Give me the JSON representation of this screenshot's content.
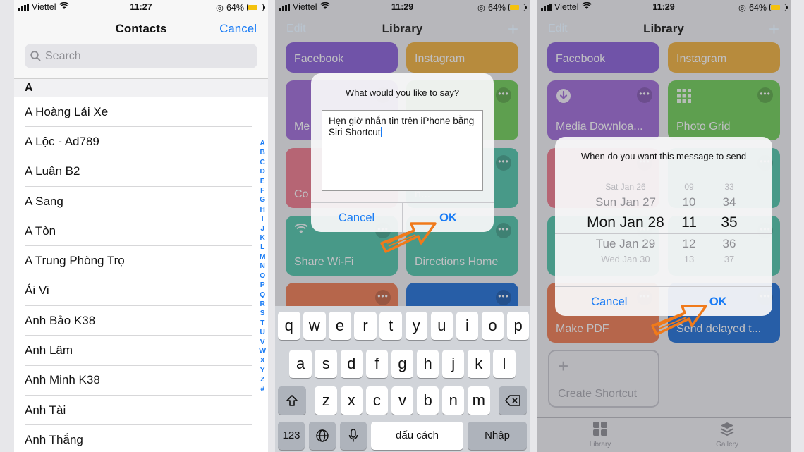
{
  "status": {
    "carrier": "Viettel",
    "battery": "64%",
    "battery_level": 0.64,
    "times": [
      "11:27",
      "11:29",
      "11:29"
    ]
  },
  "contacts": {
    "title": "Contacts",
    "cancel": "Cancel",
    "search_placeholder": "Search",
    "section": "A",
    "items": [
      "A Hoàng Lái Xe",
      "A Lộc - Ad789",
      "A Luân B2",
      "A Sang",
      "A Tòn",
      "A Trung Phòng Trọ",
      "Ái Vi",
      "Anh Bảo K38",
      "Anh Lâm",
      "Anh Minh K38",
      "Anh Tài",
      "Anh Thắng"
    ],
    "index": [
      "A",
      "B",
      "C",
      "D",
      "E",
      "F",
      "G",
      "H",
      "I",
      "J",
      "K",
      "L",
      "M",
      "N",
      "O",
      "P",
      "Q",
      "R",
      "S",
      "T",
      "U",
      "V",
      "W",
      "X",
      "Y",
      "Z",
      "#"
    ]
  },
  "library": {
    "title": "Library",
    "edit": "Edit",
    "tiles_p2": [
      {
        "label": "Facebook",
        "color": "#8a5fd8"
      },
      {
        "label": "Instagram",
        "color": "#f2b23a"
      },
      {
        "label": "Me",
        "color": "#a06ad8"
      },
      {
        "label": "",
        "color": "#6fcf55"
      },
      {
        "label": "Co",
        "color": "#f07a8b"
      },
      {
        "label": "n...",
        "color": "#4fc6a9"
      },
      {
        "label": "Share Wi-Fi",
        "color": "#4fc6a9"
      },
      {
        "label": "Directions Home",
        "color": "#4fc6a9"
      },
      {
        "label": "",
        "color": "#f07b4f"
      },
      {
        "label": "",
        "color": "#1e6fd6"
      }
    ],
    "tiles_p3": [
      {
        "label": "Facebook",
        "color": "#8a5fd8"
      },
      {
        "label": "Instagram",
        "color": "#f2b23a"
      },
      {
        "label": "Media Downloa...",
        "color": "#a06ad8"
      },
      {
        "label": "Photo Grid",
        "color": "#6fcf55"
      },
      {
        "label": "",
        "color": "#f07a8b"
      },
      {
        "label": "",
        "color": "#4fc6a9"
      },
      {
        "label": "",
        "color": "#4fc6a9"
      },
      {
        "label": "",
        "color": "#4fc6a9"
      },
      {
        "label": "Make PDF",
        "color": "#f07b4f"
      },
      {
        "label": "Send delayed t...",
        "color": "#1e6fd6"
      }
    ],
    "create_shortcut": "Create Shortcut",
    "tabs": [
      "Library",
      "Gallery"
    ]
  },
  "alert_say": {
    "message": "What would you like to say?",
    "text": "Hẹn giờ nhắn tin trên iPhone bằng Siri Shortcut",
    "cancel": "Cancel",
    "ok": "OK"
  },
  "keyboard": {
    "row1": [
      "q",
      "w",
      "e",
      "r",
      "t",
      "y",
      "u",
      "i",
      "o",
      "p"
    ],
    "row2": [
      "a",
      "s",
      "d",
      "f",
      "g",
      "h",
      "j",
      "k",
      "l"
    ],
    "row3": [
      "z",
      "x",
      "c",
      "v",
      "b",
      "n",
      "m"
    ],
    "num": "123",
    "space": "dấu cách",
    "return": "Nhập"
  },
  "alert_date": {
    "message": "When do you want this message to send",
    "dates": [
      "Sat Jan 26",
      "Sun Jan 27",
      "Mon Jan 28",
      "Tue Jan 29",
      "Wed Jan 30"
    ],
    "hours": [
      "09",
      "10",
      "11",
      "12",
      "13"
    ],
    "minutes": [
      "33",
      "34",
      "35",
      "36",
      "37"
    ],
    "cancel": "Cancel",
    "ok": "OK"
  },
  "colors": {
    "accent": "#1a7cf5",
    "arrow": "#f07a1a"
  }
}
